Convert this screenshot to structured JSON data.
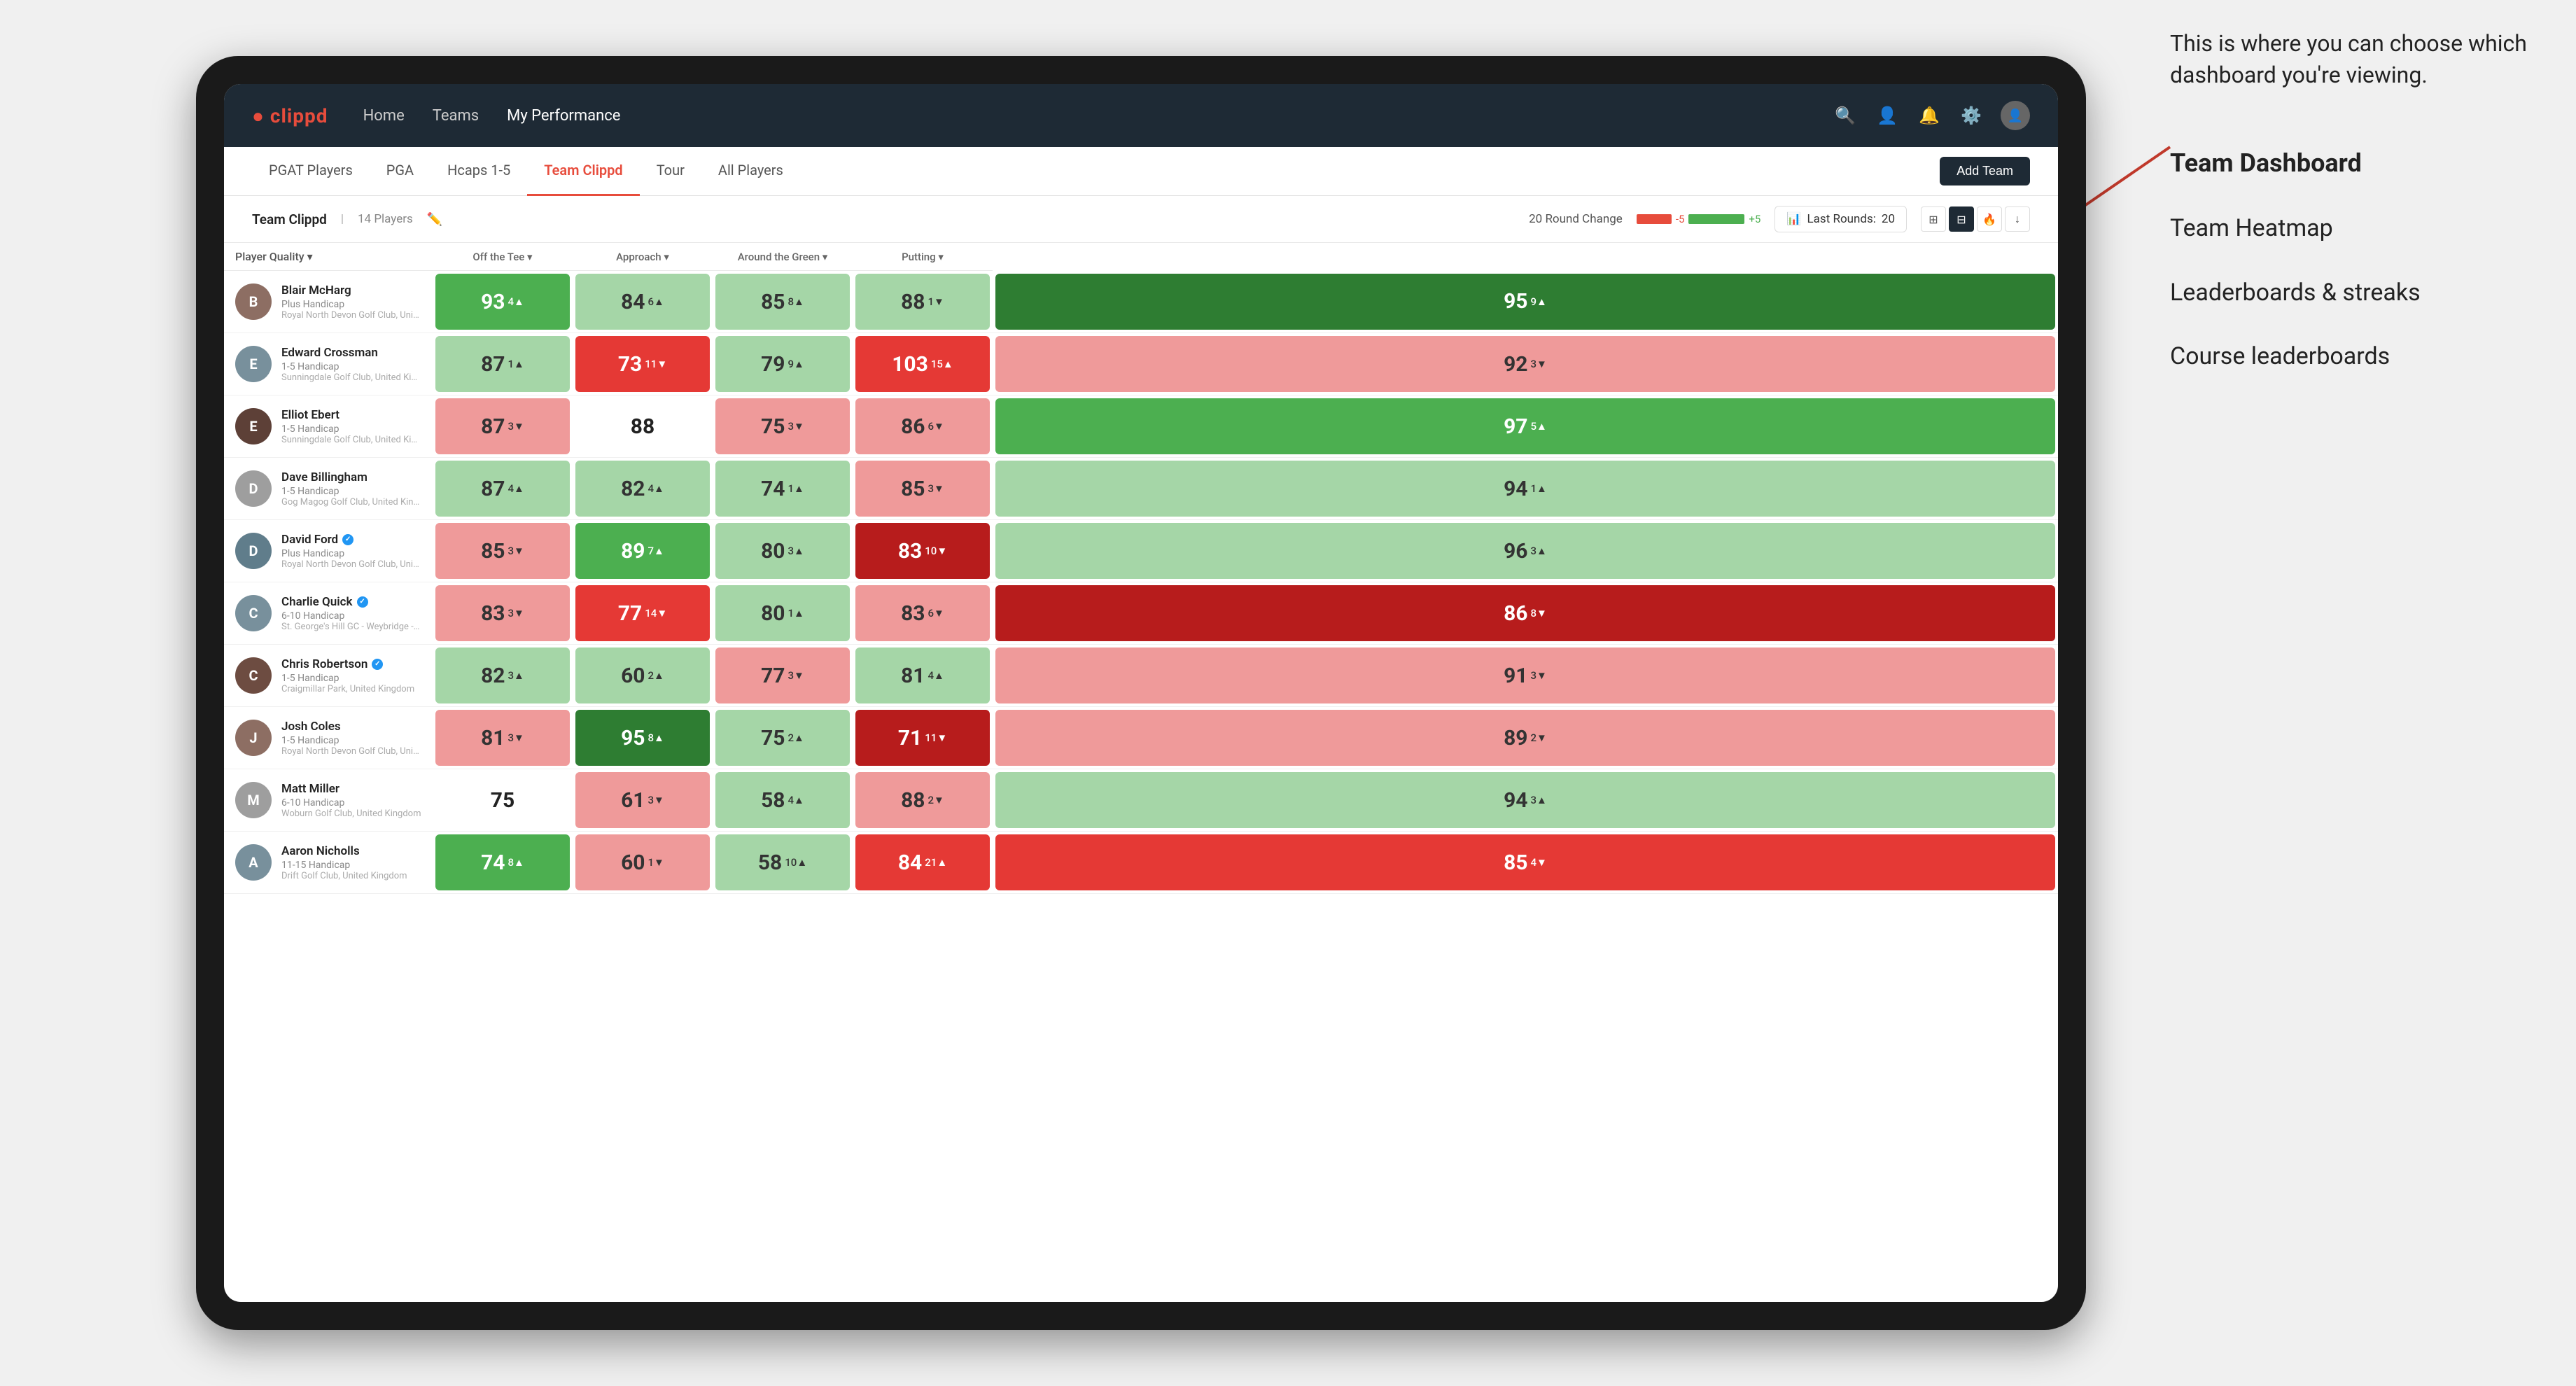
{
  "annotation": {
    "intro": "This is where you can choose which dashboard you're viewing.",
    "items": [
      "Team Dashboard",
      "Team Heatmap",
      "Leaderboards & streaks",
      "Course leaderboards"
    ]
  },
  "navbar": {
    "brand": "clippd",
    "links": [
      "Home",
      "Teams",
      "My Performance"
    ],
    "active_link": "My Performance"
  },
  "subnav": {
    "links": [
      "PGAT Players",
      "PGA",
      "Hcaps 1-5",
      "Team Clippd",
      "Tour",
      "All Players"
    ],
    "active_link": "Team Clippd",
    "add_button": "Add Team"
  },
  "team_header": {
    "name": "Team Clippd",
    "count": "14 Players",
    "round_change_label": "20 Round Change",
    "round_change_neg": "-5",
    "round_change_pos": "+5",
    "last_rounds_label": "Last Rounds:",
    "last_rounds_val": "20"
  },
  "table": {
    "columns": [
      {
        "id": "player",
        "label": "Player Quality ▾"
      },
      {
        "id": "off_tee",
        "label": "Off the Tee ▾"
      },
      {
        "id": "approach",
        "label": "Approach ▾"
      },
      {
        "id": "around_green",
        "label": "Around the Green ▾"
      },
      {
        "id": "putting",
        "label": "Putting ▾"
      }
    ],
    "rows": [
      {
        "name": "Blair McHarg",
        "handicap": "Plus Handicap",
        "club": "Royal North Devon Golf Club, United Kingdom",
        "verified": false,
        "avatar_color": "#8d6e63",
        "metrics": {
          "player_quality": {
            "val": "93",
            "delta": "4",
            "dir": "up",
            "bg": "bg-green-mid"
          },
          "off_tee": {
            "val": "84",
            "delta": "6",
            "dir": "up",
            "bg": "bg-green-light"
          },
          "approach": {
            "val": "85",
            "delta": "8",
            "dir": "up",
            "bg": "bg-green-light"
          },
          "around_green": {
            "val": "88",
            "delta": "1",
            "dir": "down",
            "bg": "bg-green-light"
          },
          "putting": {
            "val": "95",
            "delta": "9",
            "dir": "up",
            "bg": "bg-green-dark"
          }
        }
      },
      {
        "name": "Edward Crossman",
        "handicap": "1-5 Handicap",
        "club": "Sunningdale Golf Club, United Kingdom",
        "verified": false,
        "avatar_color": "#78909c",
        "metrics": {
          "player_quality": {
            "val": "87",
            "delta": "1",
            "dir": "up",
            "bg": "bg-green-light"
          },
          "off_tee": {
            "val": "73",
            "delta": "11",
            "dir": "down",
            "bg": "bg-red-mid"
          },
          "approach": {
            "val": "79",
            "delta": "9",
            "dir": "up",
            "bg": "bg-green-light"
          },
          "around_green": {
            "val": "103",
            "delta": "15",
            "dir": "up",
            "bg": "bg-red-mid"
          },
          "putting": {
            "val": "92",
            "delta": "3",
            "dir": "down",
            "bg": "bg-red-light"
          }
        }
      },
      {
        "name": "Elliot Ebert",
        "handicap": "1-5 Handicap",
        "club": "Sunningdale Golf Club, United Kingdom",
        "verified": false,
        "avatar_color": "#5d4037",
        "metrics": {
          "player_quality": {
            "val": "87",
            "delta": "3",
            "dir": "down",
            "bg": "bg-red-light"
          },
          "off_tee": {
            "val": "88",
            "delta": "",
            "dir": "",
            "bg": "bg-white"
          },
          "approach": {
            "val": "75",
            "delta": "3",
            "dir": "down",
            "bg": "bg-red-light"
          },
          "around_green": {
            "val": "86",
            "delta": "6",
            "dir": "down",
            "bg": "bg-red-light"
          },
          "putting": {
            "val": "97",
            "delta": "5",
            "dir": "up",
            "bg": "bg-green-mid"
          }
        }
      },
      {
        "name": "Dave Billingham",
        "handicap": "1-5 Handicap",
        "club": "Gog Magog Golf Club, United Kingdom",
        "verified": false,
        "avatar_color": "#9e9e9e",
        "metrics": {
          "player_quality": {
            "val": "87",
            "delta": "4",
            "dir": "up",
            "bg": "bg-green-light"
          },
          "off_tee": {
            "val": "82",
            "delta": "4",
            "dir": "up",
            "bg": "bg-green-light"
          },
          "approach": {
            "val": "74",
            "delta": "1",
            "dir": "up",
            "bg": "bg-green-light"
          },
          "around_green": {
            "val": "85",
            "delta": "3",
            "dir": "down",
            "bg": "bg-red-light"
          },
          "putting": {
            "val": "94",
            "delta": "1",
            "dir": "up",
            "bg": "bg-green-light"
          }
        }
      },
      {
        "name": "David Ford",
        "handicap": "Plus Handicap",
        "club": "Royal North Devon Golf Club, United Kingdom",
        "verified": true,
        "avatar_color": "#607d8b",
        "metrics": {
          "player_quality": {
            "val": "85",
            "delta": "3",
            "dir": "down",
            "bg": "bg-red-light"
          },
          "off_tee": {
            "val": "89",
            "delta": "7",
            "dir": "up",
            "bg": "bg-green-mid"
          },
          "approach": {
            "val": "80",
            "delta": "3",
            "dir": "up",
            "bg": "bg-green-light"
          },
          "around_green": {
            "val": "83",
            "delta": "10",
            "dir": "down",
            "bg": "bg-red-dark"
          },
          "putting": {
            "val": "96",
            "delta": "3",
            "dir": "up",
            "bg": "bg-green-light"
          }
        }
      },
      {
        "name": "Charlie Quick",
        "handicap": "6-10 Handicap",
        "club": "St. George's Hill GC - Weybridge - Surrey, Uni...",
        "verified": true,
        "avatar_color": "#78909c",
        "metrics": {
          "player_quality": {
            "val": "83",
            "delta": "3",
            "dir": "down",
            "bg": "bg-red-light"
          },
          "off_tee": {
            "val": "77",
            "delta": "14",
            "dir": "down",
            "bg": "bg-red-mid"
          },
          "approach": {
            "val": "80",
            "delta": "1",
            "dir": "up",
            "bg": "bg-green-light"
          },
          "around_green": {
            "val": "83",
            "delta": "6",
            "dir": "down",
            "bg": "bg-red-light"
          },
          "putting": {
            "val": "86",
            "delta": "8",
            "dir": "down",
            "bg": "bg-red-dark"
          }
        }
      },
      {
        "name": "Chris Robertson",
        "handicap": "1-5 Handicap",
        "club": "Craigmillar Park, United Kingdom",
        "verified": true,
        "avatar_color": "#6d4c41",
        "metrics": {
          "player_quality": {
            "val": "82",
            "delta": "3",
            "dir": "up",
            "bg": "bg-green-light"
          },
          "off_tee": {
            "val": "60",
            "delta": "2",
            "dir": "up",
            "bg": "bg-green-light"
          },
          "approach": {
            "val": "77",
            "delta": "3",
            "dir": "down",
            "bg": "bg-red-light"
          },
          "around_green": {
            "val": "81",
            "delta": "4",
            "dir": "up",
            "bg": "bg-green-light"
          },
          "putting": {
            "val": "91",
            "delta": "3",
            "dir": "down",
            "bg": "bg-red-light"
          }
        }
      },
      {
        "name": "Josh Coles",
        "handicap": "1-5 Handicap",
        "club": "Royal North Devon Golf Club, United Kingdom",
        "verified": false,
        "avatar_color": "#8d6e63",
        "metrics": {
          "player_quality": {
            "val": "81",
            "delta": "3",
            "dir": "down",
            "bg": "bg-red-light"
          },
          "off_tee": {
            "val": "95",
            "delta": "8",
            "dir": "up",
            "bg": "bg-green-dark"
          },
          "approach": {
            "val": "75",
            "delta": "2",
            "dir": "up",
            "bg": "bg-green-light"
          },
          "around_green": {
            "val": "71",
            "delta": "11",
            "dir": "down",
            "bg": "bg-red-dark"
          },
          "putting": {
            "val": "89",
            "delta": "2",
            "dir": "down",
            "bg": "bg-red-light"
          }
        }
      },
      {
        "name": "Matt Miller",
        "handicap": "6-10 Handicap",
        "club": "Woburn Golf Club, United Kingdom",
        "verified": false,
        "avatar_color": "#9e9e9e",
        "metrics": {
          "player_quality": {
            "val": "75",
            "delta": "",
            "dir": "",
            "bg": "bg-white"
          },
          "off_tee": {
            "val": "61",
            "delta": "3",
            "dir": "down",
            "bg": "bg-red-light"
          },
          "approach": {
            "val": "58",
            "delta": "4",
            "dir": "up",
            "bg": "bg-green-light"
          },
          "around_green": {
            "val": "88",
            "delta": "2",
            "dir": "down",
            "bg": "bg-red-light"
          },
          "putting": {
            "val": "94",
            "delta": "3",
            "dir": "up",
            "bg": "bg-green-light"
          }
        }
      },
      {
        "name": "Aaron Nicholls",
        "handicap": "11-15 Handicap",
        "club": "Drift Golf Club, United Kingdom",
        "verified": false,
        "avatar_color": "#78909c",
        "metrics": {
          "player_quality": {
            "val": "74",
            "delta": "8",
            "dir": "up",
            "bg": "bg-green-mid"
          },
          "off_tee": {
            "val": "60",
            "delta": "1",
            "dir": "down",
            "bg": "bg-red-light"
          },
          "approach": {
            "val": "58",
            "delta": "10",
            "dir": "up",
            "bg": "bg-green-light"
          },
          "around_green": {
            "val": "84",
            "delta": "21",
            "dir": "up",
            "bg": "bg-red-mid"
          },
          "putting": {
            "val": "85",
            "delta": "4",
            "dir": "down",
            "bg": "bg-red-mid"
          }
        }
      }
    ]
  }
}
